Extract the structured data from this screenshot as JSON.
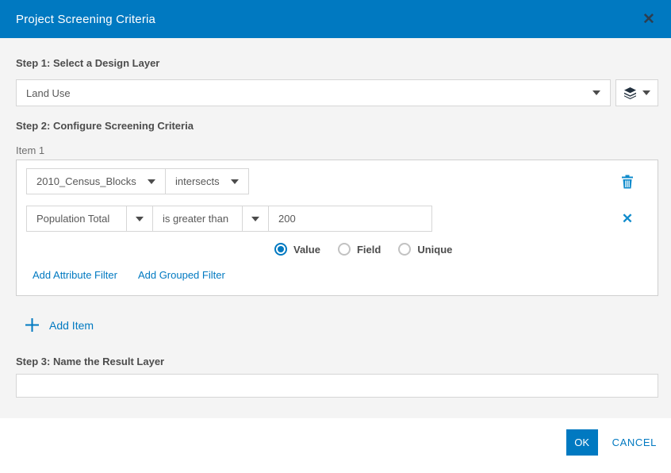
{
  "header": {
    "title": "Project Screening Criteria"
  },
  "icons": {
    "close": "✕",
    "remove": "✕"
  },
  "step1": {
    "heading": "Step 1: Select a Design Layer",
    "layer_select_value": "Land Use"
  },
  "step2": {
    "heading": "Step 2: Configure Screening Criteria",
    "item_label": "Item 1",
    "criteria_layer_value": "2010_Census_Blocks",
    "operator_value": "intersects",
    "attribute_field_value": "Population Total",
    "condition_value": "is greater than",
    "value_input": "200",
    "radios": [
      {
        "label": "Value",
        "selected": true
      },
      {
        "label": "Field",
        "selected": false
      },
      {
        "label": "Unique",
        "selected": false
      }
    ],
    "add_attribute_filter_label": "Add Attribute Filter",
    "add_grouped_filter_label": "Add Grouped Filter",
    "add_item_label": "Add Item"
  },
  "step3": {
    "heading": "Step 3: Name the Result Layer",
    "input_value": ""
  },
  "footer": {
    "ok_label": "OK",
    "cancel_label": "CANCEL"
  },
  "colors": {
    "accent": "#0079c1",
    "header_bg": "#0079c1",
    "content_bg": "#f4f4f4",
    "border": "#d6d6d6"
  }
}
